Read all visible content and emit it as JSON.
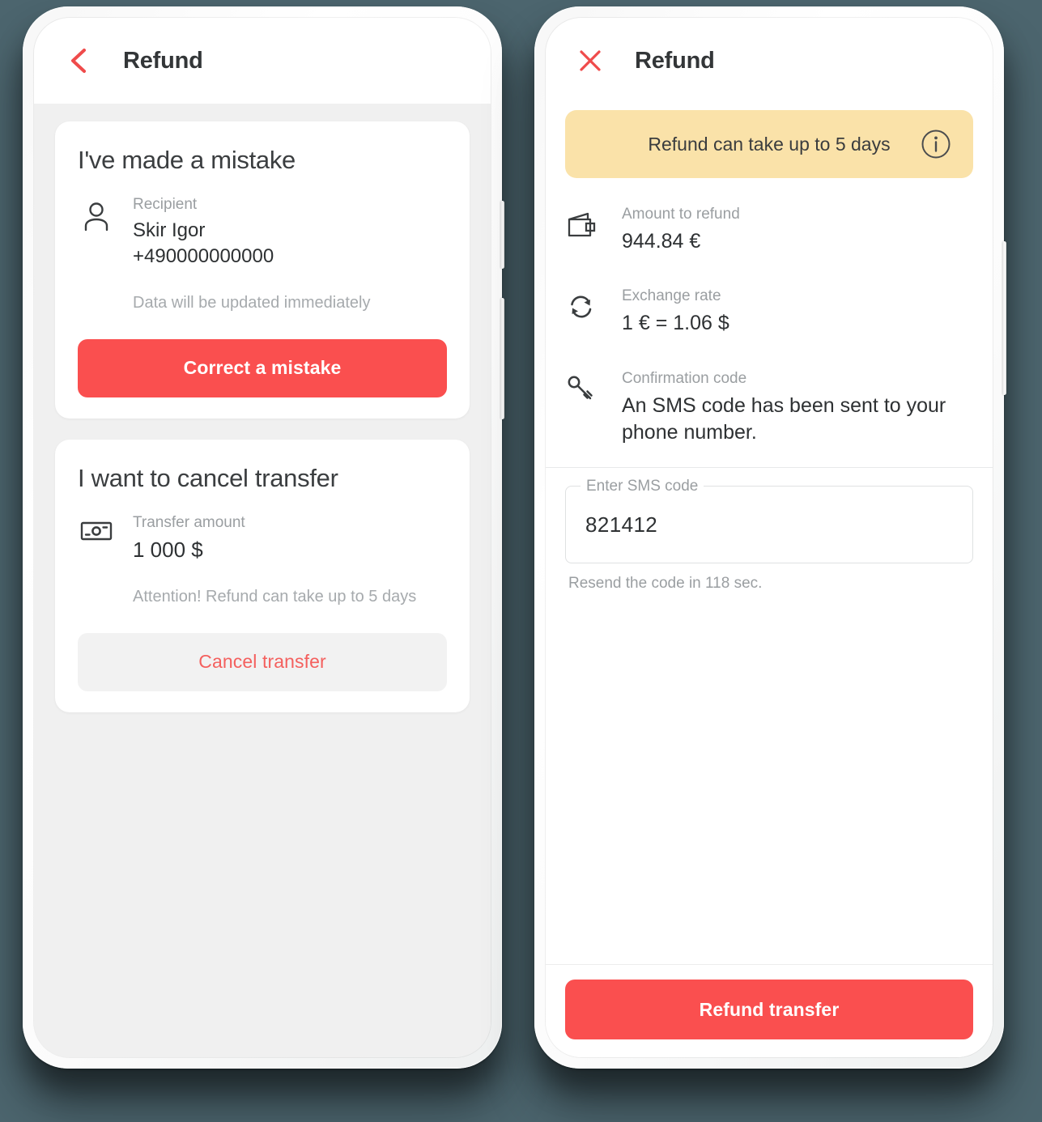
{
  "theme": {
    "page_background": "#4c656e",
    "accent_red": "#fa4f4f",
    "banner_yellow": "#fae2a9",
    "screen_grey": "#f0f0f0",
    "text_dark": "#2e3133",
    "text_muted": "#9a9ea1"
  },
  "left_phone": {
    "header": {
      "back_icon": "chevron-left-icon",
      "title": "Refund"
    },
    "mistake_card": {
      "title": "I've made a mistake",
      "recipient": {
        "icon": "person-icon",
        "label": "Recipient",
        "name": "Skir Igor",
        "phone": "+490000000000"
      },
      "note": "Data will be updated immediately",
      "button_label": "Correct a mistake"
    },
    "cancel_card": {
      "title": "I want to cancel transfer",
      "amount": {
        "icon": "banknote-icon",
        "label": "Transfer amount",
        "value": "1 000 $"
      },
      "note": "Attention! Refund can take up to 5 days",
      "button_label": "Cancel transfer"
    }
  },
  "right_phone": {
    "header": {
      "close_icon": "close-icon",
      "title": "Refund"
    },
    "banner": {
      "text": "Refund can take up to 5 days",
      "icon": "info-icon"
    },
    "details": [
      {
        "icon": "wallet-icon",
        "label": "Amount to refund",
        "value": "944.84 €"
      },
      {
        "icon": "exchange-icon",
        "label": "Exchange rate",
        "value": "1 € = 1.06 $"
      },
      {
        "icon": "key-icon",
        "label": "Confirmation code",
        "value": "An SMS code has been sent to your phone number."
      }
    ],
    "sms_field": {
      "legend": "Enter SMS code",
      "value": "821412",
      "placeholder": "Enter SMS code",
      "resend_text": "Resend the code in 118 sec."
    },
    "footer": {
      "button_label": "Refund transfer"
    }
  }
}
